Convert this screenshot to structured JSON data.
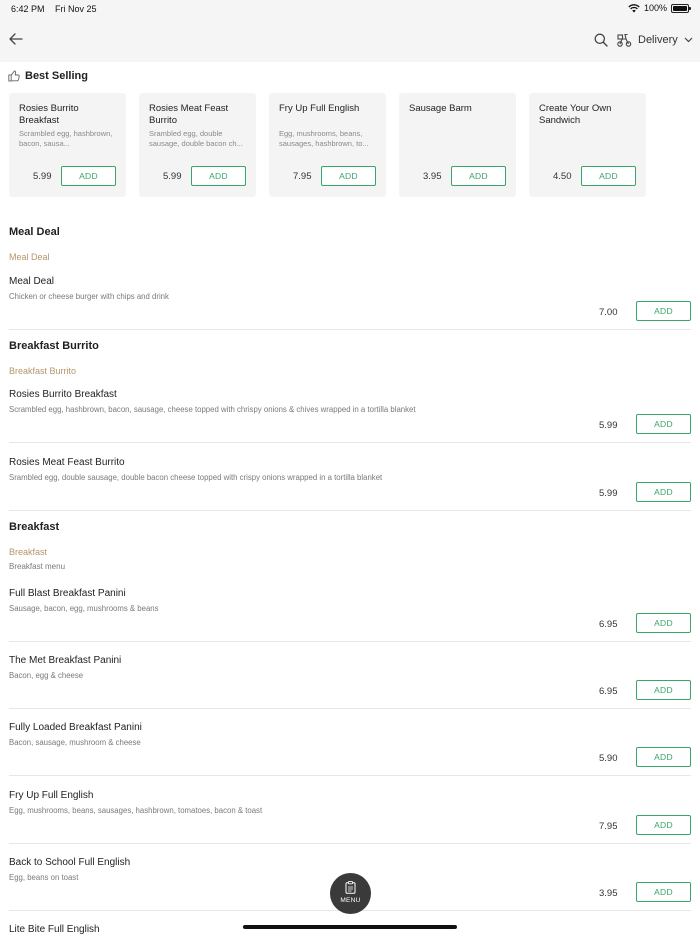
{
  "status": {
    "time": "6:42 PM",
    "date": "Fri Nov 25",
    "battery": "100%"
  },
  "header": {
    "back_icon": "arrow-left-icon",
    "search_icon": "search-icon",
    "delivery_icon": "scooter-icon",
    "delivery_label": "Delivery"
  },
  "best_selling": {
    "title": "Best Selling",
    "items": [
      {
        "name": "Rosies Burrito Breakfast",
        "desc": "Scrambled egg, hashbrown, bacon, sausa...",
        "price": "5.99",
        "add": "ADD"
      },
      {
        "name": "Rosies Meat Feast Burrito",
        "desc": "Srambled egg, double sausage, double bacon ch...",
        "price": "5.99",
        "add": "ADD"
      },
      {
        "name": "Fry Up Full English",
        "desc": "Egg, mushrooms, beans, sausages, hashbrown, to...",
        "price": "7.95",
        "add": "ADD"
      },
      {
        "name": "Sausage Barm",
        "desc": "",
        "price": "3.95",
        "add": "ADD"
      },
      {
        "name": "Create Your Own Sandwich",
        "desc": "",
        "price": "4.50",
        "add": "ADD"
      }
    ]
  },
  "sections": [
    {
      "title": "Meal Deal",
      "subtitle": "Meal Deal",
      "items": [
        {
          "name": "Meal Deal",
          "desc": "Chicken or cheese burger with chips and drink",
          "price": "7.00",
          "add": "ADD"
        }
      ]
    },
    {
      "title": "Breakfast Burrito",
      "subtitle": "Breakfast Burrito",
      "items": [
        {
          "name": "Rosies Burrito Breakfast",
          "desc": "Scrambled egg, hashbrown, bacon, sausage, cheese topped with chrispy onions & chives wrapped in a tortilla blanket",
          "price": "5.99",
          "add": "ADD"
        },
        {
          "name": "Rosies Meat Feast Burrito",
          "desc": "Srambled egg, double sausage, double bacon cheese topped with crispy onions wrapped in a tortilla blanket",
          "price": "5.99",
          "add": "ADD"
        }
      ]
    },
    {
      "title": "Breakfast",
      "subtitle": "Breakfast",
      "description": "Breakfast menu",
      "items": [
        {
          "name": "Full Blast Breakfast Panini",
          "desc": "Sausage, bacon, egg, mushrooms & beans",
          "price": "6.95",
          "add": "ADD"
        },
        {
          "name": "The Met Breakfast Panini",
          "desc": "Bacon, egg & cheese",
          "price": "6.95",
          "add": "ADD"
        },
        {
          "name": "Fully Loaded Breakfast Panini",
          "desc": "Bacon, sausage, mushroom & cheese",
          "price": "5.90",
          "add": "ADD"
        },
        {
          "name": "Fry Up Full English",
          "desc": "Egg, mushrooms, beans, sausages, hashbrown, tomatoes, bacon & toast",
          "price": "7.95",
          "add": "ADD"
        },
        {
          "name": "Back to School Full English",
          "desc": "Egg, beans on toast",
          "price": "3.95",
          "add": "ADD"
        },
        {
          "name": "Lite Bite Full English",
          "desc": "",
          "price": "",
          "add": ""
        }
      ]
    }
  ],
  "fab": {
    "label": "MENU",
    "icon": "clipboard-icon"
  },
  "colors": {
    "accent": "#3aa569",
    "subtitle": "#b4966a",
    "fab": "#3a3a3a",
    "card_bg": "#f4f4f4",
    "header_bg": "#f5f5f5"
  }
}
